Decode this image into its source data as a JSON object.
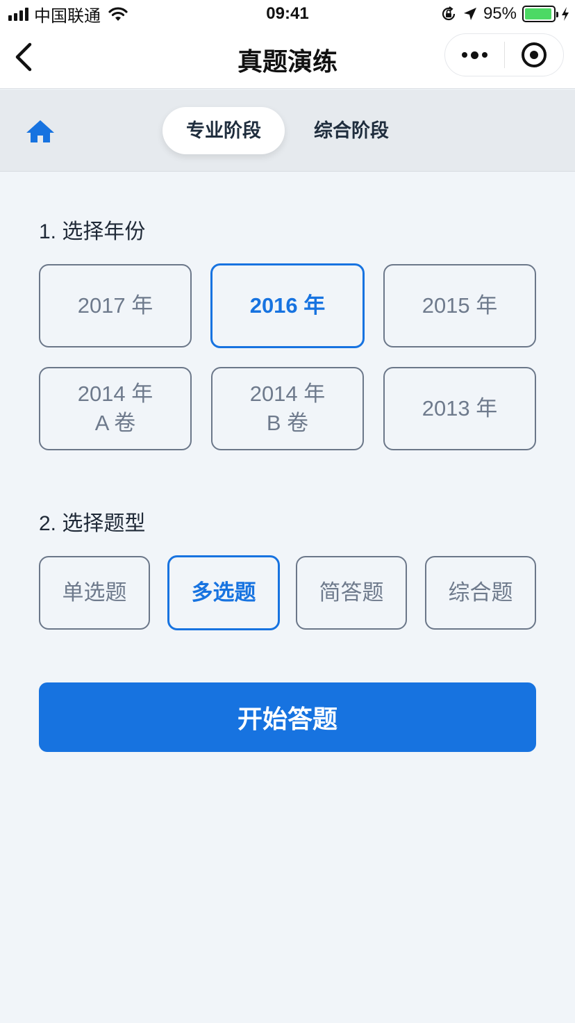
{
  "status_bar": {
    "carrier": "中国联通",
    "time": "09:41",
    "battery_percent": "95%",
    "battery_level": 0.95,
    "battery_color": "#4cd964",
    "icons": [
      "signal-icon",
      "wifi-icon",
      "orientation-lock-icon",
      "location-arrow-icon",
      "battery-icon",
      "charging-bolt-icon"
    ]
  },
  "nav": {
    "title": "真题演练",
    "back_icon": "chevron-left-icon",
    "more_icon": "more-dots-icon",
    "close_icon": "target-circle-icon"
  },
  "tabs": {
    "home_icon": "home-icon",
    "items": [
      {
        "label": "专业阶段",
        "active": true
      },
      {
        "label": "综合阶段",
        "active": false
      }
    ]
  },
  "year_section": {
    "title": "1. 选择年份",
    "options": [
      {
        "line1": "2017 年",
        "line2": "",
        "selected": false
      },
      {
        "line1": "2016 年",
        "line2": "",
        "selected": true
      },
      {
        "line1": "2015 年",
        "line2": "",
        "selected": false
      },
      {
        "line1": "2014 年",
        "line2": "A 卷",
        "selected": false
      },
      {
        "line1": "2014 年",
        "line2": "B 卷",
        "selected": false
      },
      {
        "line1": "2013 年",
        "line2": "",
        "selected": false
      }
    ]
  },
  "type_section": {
    "title": "2. 选择题型",
    "options": [
      {
        "label": "单选题",
        "selected": false
      },
      {
        "label": "多选题",
        "selected": true
      },
      {
        "label": "简答题",
        "selected": false
      },
      {
        "label": "综合题",
        "selected": false
      }
    ]
  },
  "start_button": {
    "label": "开始答题"
  },
  "colors": {
    "accent": "#1773e0",
    "page_background": "#f1f5f9",
    "tab_background": "#e6eaee",
    "option_border": "#6b7789",
    "option_text": "#6e7a8c"
  }
}
